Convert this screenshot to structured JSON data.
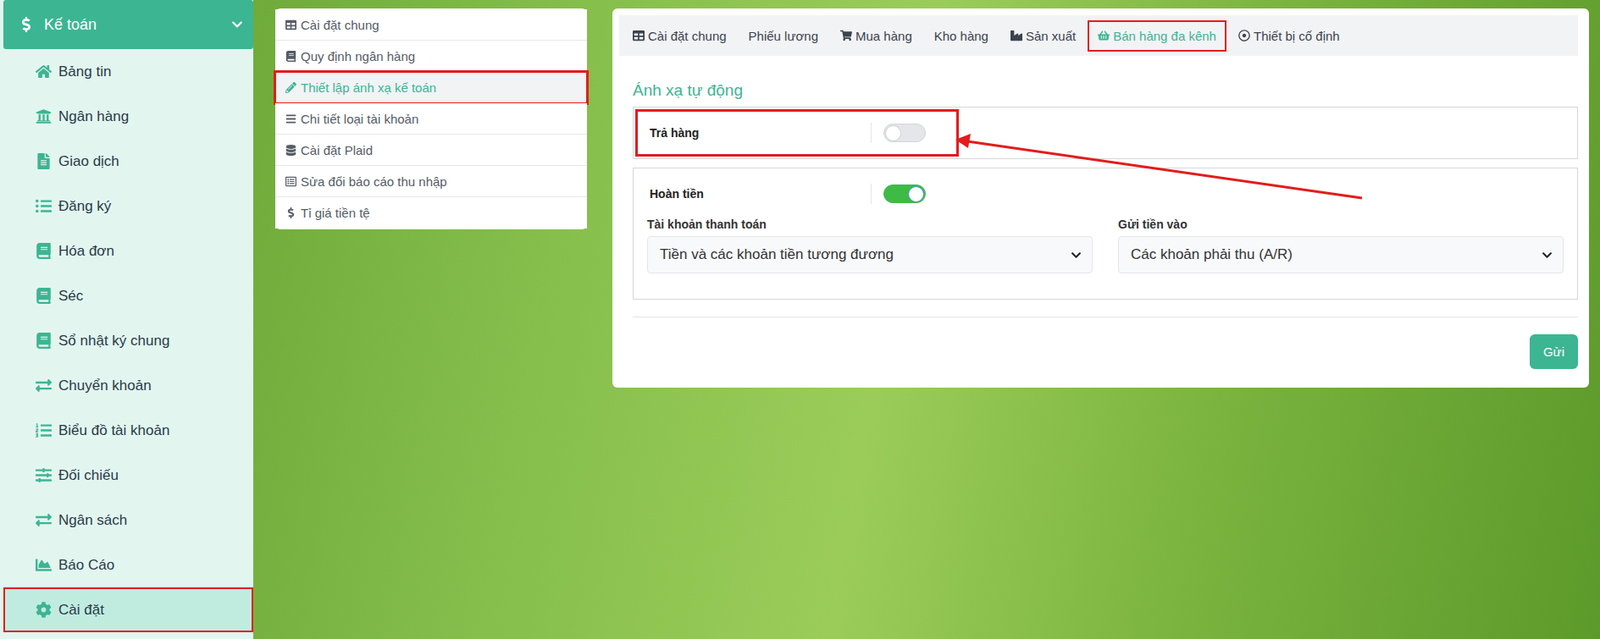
{
  "sidebar": {
    "header": {
      "label": "Kế toán",
      "expanded": true
    },
    "items": [
      {
        "label": "Bảng tin",
        "selected": false,
        "highlighted": false
      },
      {
        "label": "Ngân hàng",
        "selected": false,
        "highlighted": false
      },
      {
        "label": "Giao dịch",
        "selected": false,
        "highlighted": false
      },
      {
        "label": "Đăng ký",
        "selected": false,
        "highlighted": false
      },
      {
        "label": "Hóa đơn",
        "selected": false,
        "highlighted": false
      },
      {
        "label": "Séc",
        "selected": false,
        "highlighted": false
      },
      {
        "label": "Sổ nhật ký chung",
        "selected": false,
        "highlighted": false
      },
      {
        "label": "Chuyển khoản",
        "selected": false,
        "highlighted": false
      },
      {
        "label": "Biểu đồ tài khoản",
        "selected": false,
        "highlighted": false
      },
      {
        "label": "Đối chiếu",
        "selected": false,
        "highlighted": false
      },
      {
        "label": "Ngân sách",
        "selected": false,
        "highlighted": false
      },
      {
        "label": "Báo Cáo",
        "selected": false,
        "highlighted": false
      },
      {
        "label": "Cài đặt",
        "selected": true,
        "highlighted": true
      }
    ]
  },
  "settings_menu": {
    "items": [
      {
        "label": "Cài đặt chung",
        "selected": false,
        "highlighted": false
      },
      {
        "label": "Quy định ngân hàng",
        "selected": false,
        "highlighted": false
      },
      {
        "label": "Thiết lập ánh xạ kế toán",
        "selected": true,
        "highlighted": true
      },
      {
        "label": "Chi tiết loại tài khoản",
        "selected": false,
        "highlighted": false
      },
      {
        "label": "Cài đặt Plaid",
        "selected": false,
        "highlighted": false
      },
      {
        "label": "Sửa đổi báo cáo thu nhập",
        "selected": false,
        "highlighted": false
      },
      {
        "label": "Tỉ giá tiền tệ",
        "selected": false,
        "highlighted": false
      }
    ]
  },
  "tabs": [
    {
      "label": "Cài đặt chung",
      "selected": false,
      "highlighted": false
    },
    {
      "label": "Phiếu lương",
      "selected": false,
      "highlighted": false
    },
    {
      "label": "Mua hàng",
      "selected": false,
      "highlighted": false
    },
    {
      "label": "Kho hàng",
      "selected": false,
      "highlighted": false
    },
    {
      "label": "Sản xuất",
      "selected": false,
      "highlighted": false
    },
    {
      "label": "Bán hàng đa kênh",
      "selected": true,
      "highlighted": true
    },
    {
      "label": "Thiết bị cố định",
      "selected": false,
      "highlighted": false
    }
  ],
  "section": {
    "title": "Ánh xạ tự động"
  },
  "mappings": [
    {
      "label": "Trả hàng",
      "on": false,
      "highlighted": true,
      "fields": []
    },
    {
      "label": "Hoàn tiền",
      "on": true,
      "highlighted": false,
      "fields": [
        {
          "label": "Tài khoản thanh toán",
          "value": "Tiền và các khoản tiền tương đương"
        },
        {
          "label": "Gửi tiền vào",
          "value": "Các khoản phải thu (A/R)"
        }
      ]
    }
  ],
  "buttons": [
    "Gửi"
  ],
  "annotation": {
    "arrow": true
  }
}
